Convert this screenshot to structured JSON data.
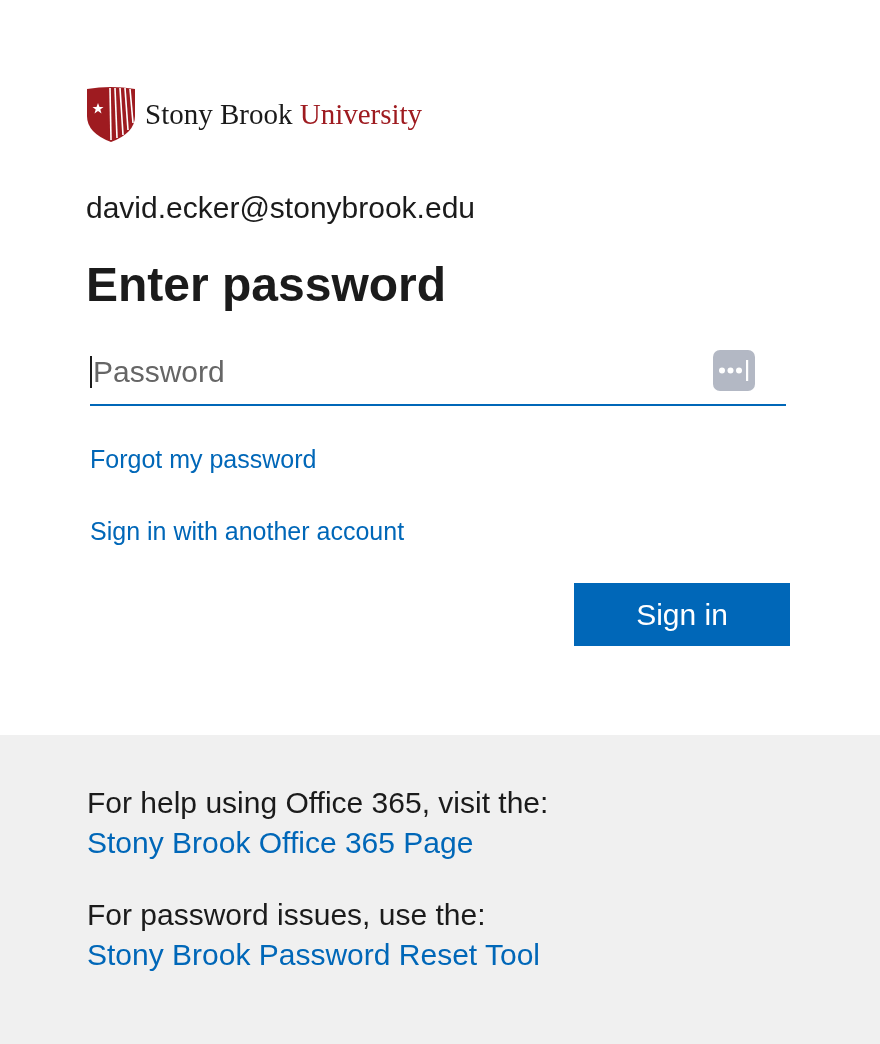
{
  "logo": {
    "wordmark": "Stony Brook",
    "wordmark_accent": "University"
  },
  "account": "david.ecker@stonybrook.edu",
  "title": "Enter password",
  "password_field": {
    "placeholder": "Password",
    "focused": true
  },
  "links": [
    "Forgot my password",
    "Sign in with another account"
  ],
  "primary_button": "Sign in",
  "footer": [
    {
      "text": "For help using Office 365, visit the:",
      "link": "Stony Brook Office 365 Page"
    },
    {
      "text": "For password issues, use the:",
      "link": "Stony Brook Password Reset Tool"
    }
  ]
}
